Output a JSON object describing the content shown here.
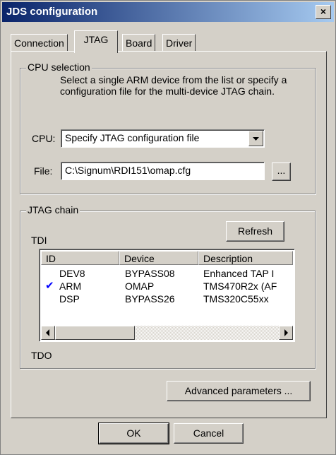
{
  "window": {
    "title": "JDS configuration",
    "close_glyph": "×"
  },
  "tabs": [
    {
      "label": "Connection",
      "active": false
    },
    {
      "label": "JTAG",
      "active": true
    },
    {
      "label": "Board",
      "active": false
    },
    {
      "label": "Driver",
      "active": false
    }
  ],
  "cpu_selection": {
    "legend": "CPU selection",
    "description": "Select a single ARM device from the list or specify a configuration file for the multi-device JTAG chain.",
    "cpu_label": "CPU:",
    "cpu_value": "Specify JTAG configuration file",
    "file_label": "File:",
    "file_value": "C:\\Signum\\RDI151\\omap.cfg",
    "browse_label": "..."
  },
  "jtag_chain": {
    "legend": "JTAG chain",
    "tdi_label": "TDI",
    "tdo_label": "TDO",
    "refresh_label": "Refresh",
    "columns": [
      "ID",
      "Device",
      "Description"
    ],
    "rows": [
      {
        "checked": false,
        "id": "DEV8",
        "device": "BYPASS08",
        "description": "Enhanced TAP I"
      },
      {
        "checked": true,
        "id": "ARM",
        "device": "OMAP",
        "description": "TMS470R2x (AF"
      },
      {
        "checked": false,
        "id": "DSP",
        "device": "BYPASS26",
        "description": "TMS320C55xx"
      }
    ],
    "check_glyph": "✔",
    "scrollbar_fraction": 0.35
  },
  "advanced_label": "Advanced parameters ...",
  "ok_label": "OK",
  "cancel_label": "Cancel",
  "colors": {
    "title_start": "#0a246a",
    "title_end": "#a6caf0",
    "check": "#0000ff"
  },
  "icons": [
    "chevron-down-icon",
    "chevron-left-icon",
    "chevron-right-icon",
    "close-icon",
    "check-icon"
  ]
}
